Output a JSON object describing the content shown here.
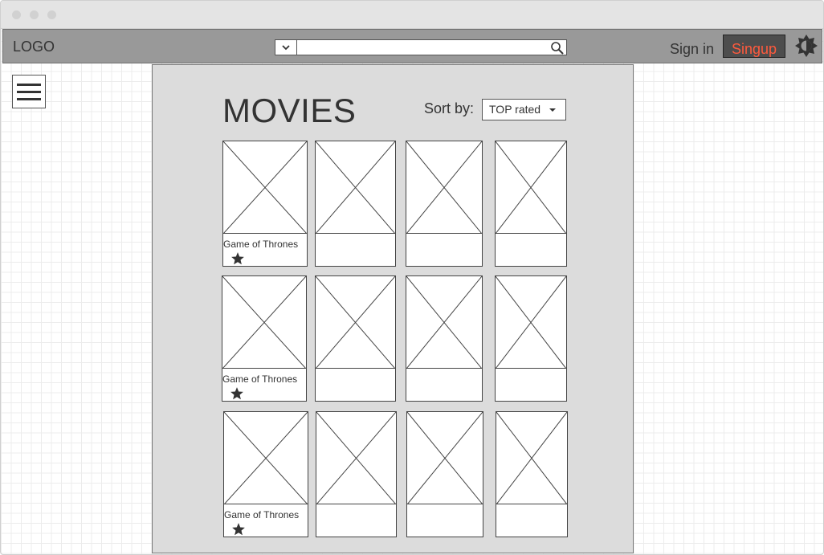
{
  "window": {
    "controls": [
      "close",
      "minimize",
      "maximize"
    ]
  },
  "navbar": {
    "logo": "LOGO",
    "search": {
      "filter_icon": "chevron-down-icon",
      "value": "",
      "icon": "search-icon"
    },
    "signin_label": "Sign in",
    "signup_label": "Singup",
    "theme_icon": "brightness-icon",
    "signup_text_color": "#ff5a3d"
  },
  "sidebar": {
    "menu_icon": "hamburger-icon"
  },
  "main": {
    "title": "MOVIES",
    "sort": {
      "label": "Sort by:",
      "selected": "TOP rated"
    },
    "rows": [
      {
        "cards": [
          {
            "title": "Game of Thrones",
            "rating_icon": "star-icon"
          },
          {
            "title": ""
          },
          {
            "title": ""
          },
          {
            "title": ""
          }
        ]
      },
      {
        "cards": [
          {
            "title": "Game of Thrones",
            "rating_icon": "star-icon"
          },
          {
            "title": ""
          },
          {
            "title": ""
          },
          {
            "title": ""
          }
        ]
      },
      {
        "cards": [
          {
            "title": "Game of Thrones",
            "rating_icon": "star-icon"
          },
          {
            "title": ""
          },
          {
            "title": ""
          },
          {
            "title": ""
          }
        ]
      }
    ]
  }
}
